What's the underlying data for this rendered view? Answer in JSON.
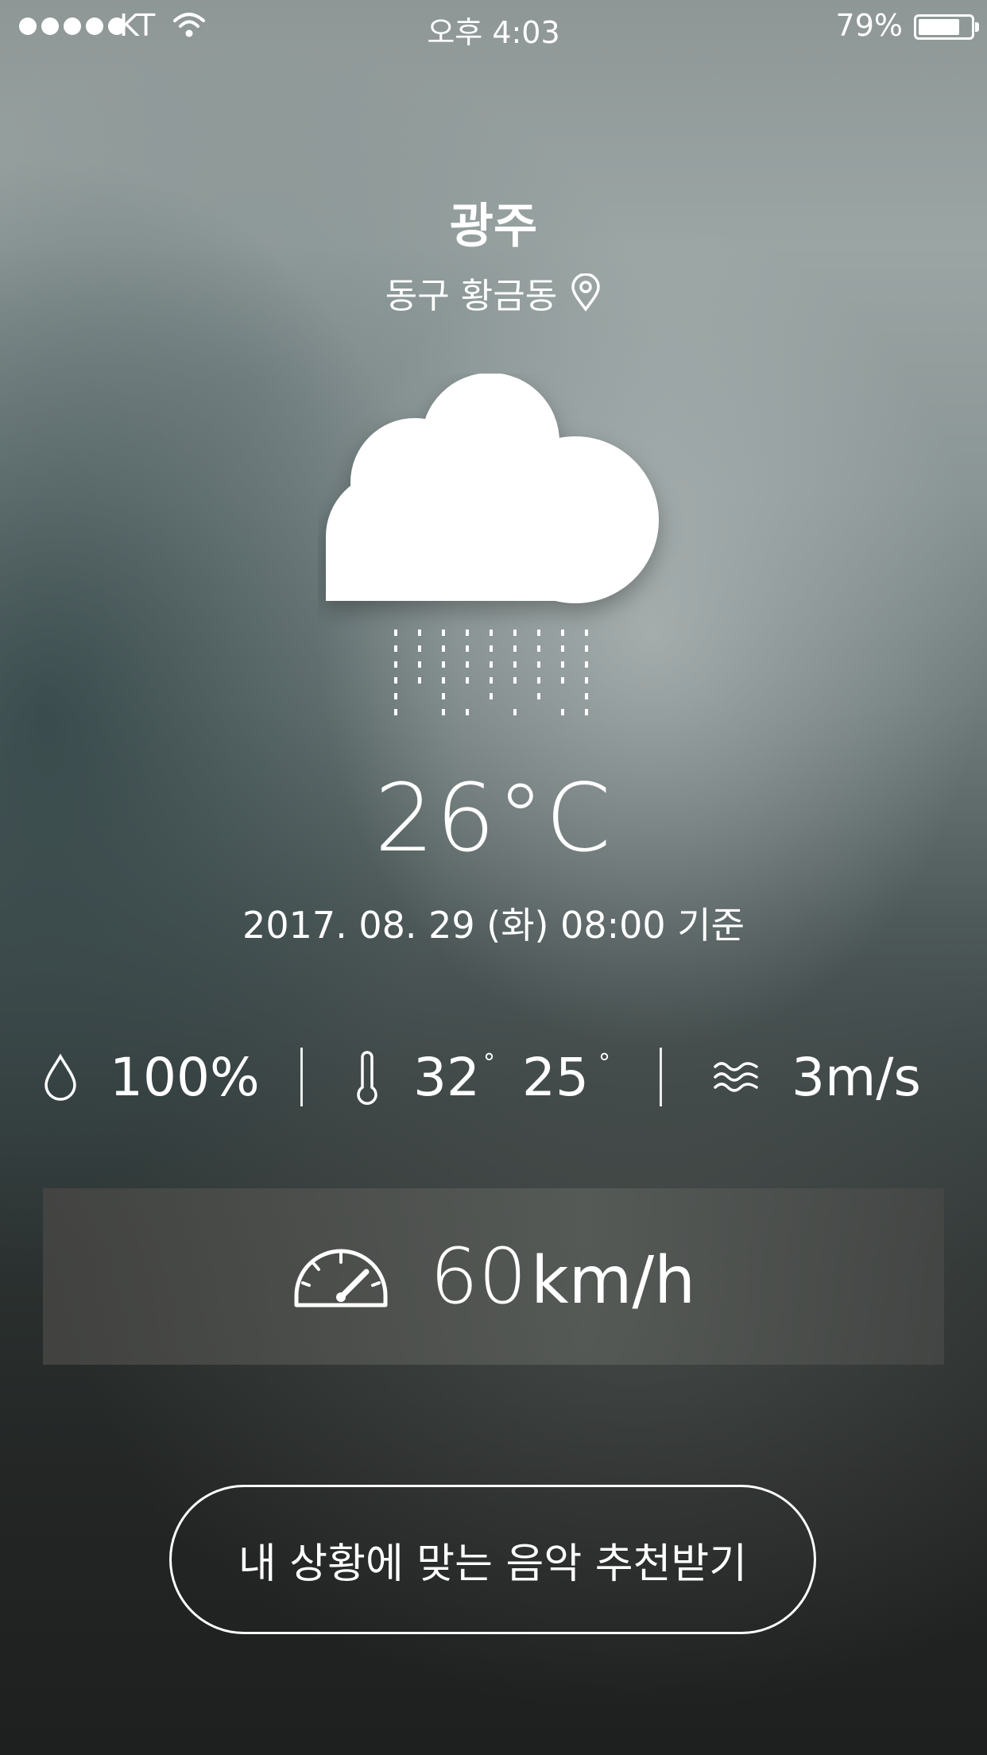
{
  "status_bar": {
    "carrier": "KT",
    "time": "오후 4:03",
    "battery_percent": "79%",
    "battery_level": 0.79,
    "signal_bars": 5
  },
  "location": {
    "city": "광주",
    "district": "동구 황금동",
    "icon": "location-pin-icon"
  },
  "weather": {
    "condition_icon": "rain-cloud-icon",
    "temperature": "26°C",
    "date": "2017. 08. 29 (화) 08:00 기준"
  },
  "stats": {
    "humidity": {
      "icon": "water-drop-icon",
      "value": "100%"
    },
    "temperature_range": {
      "icon": "thermometer-icon",
      "high": "32",
      "low": "25",
      "degree_symbol": "°"
    },
    "wind": {
      "icon": "wind-icon",
      "value": "3m/s"
    }
  },
  "speed": {
    "icon": "speedometer-icon",
    "value": "60",
    "unit": "km/h"
  },
  "cta": {
    "label": "내 상황에 맞는 음악 추천받기"
  },
  "colors": {
    "text": "#ffffff",
    "background_top": "#8e9796",
    "background_bottom": "#1e201f"
  }
}
